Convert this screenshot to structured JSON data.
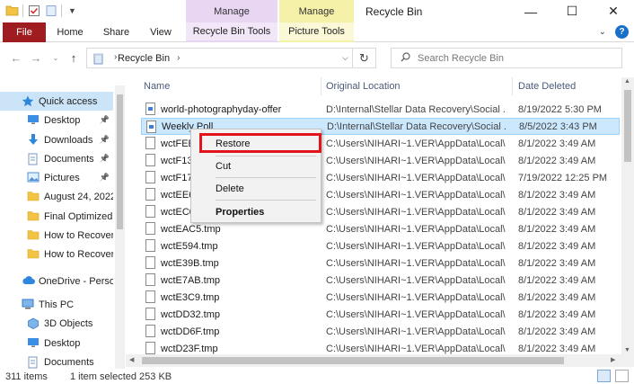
{
  "titlebar": {
    "title": "Recycle Bin",
    "manage_1": "Manage",
    "manage_2": "Manage"
  },
  "ribbon": {
    "file": "File",
    "home": "Home",
    "share": "Share",
    "view": "View",
    "recycle_bin_tools": "Recycle Bin Tools",
    "picture_tools": "Picture Tools"
  },
  "address": {
    "path": "Recycle Bin",
    "search_placeholder": "Search Recycle Bin"
  },
  "sidebar": {
    "items": [
      {
        "label": "Quick access",
        "icon": "star-icon"
      },
      {
        "label": "Desktop",
        "icon": "desktop-icon"
      },
      {
        "label": "Downloads",
        "icon": "download-icon"
      },
      {
        "label": "Documents",
        "icon": "documents-icon"
      },
      {
        "label": "Pictures",
        "icon": "pictures-icon"
      },
      {
        "label": "August 24, 2022",
        "icon": "folder-icon"
      },
      {
        "label": "Final Optimized",
        "icon": "folder-icon"
      },
      {
        "label": "How to Recover",
        "icon": "folder-icon"
      },
      {
        "label": "How to Recover",
        "icon": "folder-icon"
      },
      {
        "label": "OneDrive - Person",
        "icon": "cloud-icon"
      },
      {
        "label": "This PC",
        "icon": "pc-icon"
      },
      {
        "label": "3D Objects",
        "icon": "cube-icon"
      },
      {
        "label": "Desktop",
        "icon": "desktop-icon"
      },
      {
        "label": "Documents",
        "icon": "documents-icon"
      }
    ]
  },
  "columns": {
    "name": "Name",
    "original_location": "Original Location",
    "date_deleted": "Date Deleted"
  },
  "files": [
    {
      "name": "world-photographyday-offer",
      "location": "D:\\Internal\\Stellar Data Recovery\\Social ...",
      "date": "8/19/2022 5:30 PM",
      "icon": "image-file-icon"
    },
    {
      "name": "Weekly Poll",
      "location": "D:\\Internal\\Stellar Data Recovery\\Social ...",
      "date": "8/5/2022 3:43 PM",
      "icon": "image-file-icon"
    },
    {
      "name": "wctFEE",
      "location": "C:\\Users\\NIHARI~1.VER\\AppData\\Local\\...",
      "date": "8/1/2022 3:49 AM",
      "icon": "file-icon"
    },
    {
      "name": "wctF13",
      "location": "C:\\Users\\NIHARI~1.VER\\AppData\\Local\\...",
      "date": "8/1/2022 3:49 AM",
      "icon": "file-icon"
    },
    {
      "name": "wctF17",
      "location": "C:\\Users\\NIHARI~1.VER\\AppData\\Local\\...",
      "date": "7/19/2022 12:25 PM",
      "icon": "file-icon"
    },
    {
      "name": "wctEE6",
      "location": "C:\\Users\\NIHARI~1.VER\\AppData\\Local\\...",
      "date": "8/1/2022 3:49 AM",
      "icon": "file-icon"
    },
    {
      "name": "wctEC0",
      "location": "C:\\Users\\NIHARI~1.VER\\AppData\\Local\\...",
      "date": "8/1/2022 3:49 AM",
      "icon": "file-icon"
    },
    {
      "name": "wctEAC5.tmp",
      "location": "C:\\Users\\NIHARI~1.VER\\AppData\\Local\\...",
      "date": "8/1/2022 3:49 AM",
      "icon": "file-icon"
    },
    {
      "name": "wctE594.tmp",
      "location": "C:\\Users\\NIHARI~1.VER\\AppData\\Local\\...",
      "date": "8/1/2022 3:49 AM",
      "icon": "file-icon"
    },
    {
      "name": "wctE39B.tmp",
      "location": "C:\\Users\\NIHARI~1.VER\\AppData\\Local\\...",
      "date": "8/1/2022 3:49 AM",
      "icon": "file-icon"
    },
    {
      "name": "wctE7AB.tmp",
      "location": "C:\\Users\\NIHARI~1.VER\\AppData\\Local\\...",
      "date": "8/1/2022 3:49 AM",
      "icon": "file-icon"
    },
    {
      "name": "wctE3C9.tmp",
      "location": "C:\\Users\\NIHARI~1.VER\\AppData\\Local\\...",
      "date": "8/1/2022 3:49 AM",
      "icon": "file-icon"
    },
    {
      "name": "wctDD32.tmp",
      "location": "C:\\Users\\NIHARI~1.VER\\AppData\\Local\\...",
      "date": "8/1/2022 3:49 AM",
      "icon": "file-icon"
    },
    {
      "name": "wctDD6F.tmp",
      "location": "C:\\Users\\NIHARI~1.VER\\AppData\\Local\\...",
      "date": "8/1/2022 3:49 AM",
      "icon": "file-icon"
    },
    {
      "name": "wctD23F.tmp",
      "location": "C:\\Users\\NIHARI~1.VER\\AppData\\Local\\...",
      "date": "8/1/2022 3:49 AM",
      "icon": "file-icon"
    }
  ],
  "selected_index": 1,
  "context_menu": {
    "restore": "Restore",
    "cut": "Cut",
    "delete": "Delete",
    "properties": "Properties"
  },
  "status": {
    "items": "311 items",
    "selection": "1 item selected  253 KB"
  },
  "colors": {
    "file_tab": "#9f1d20",
    "manage_purple": "#e8d6f3",
    "manage_yellow": "#f6f1a9",
    "selection": "#cce8ff",
    "highlight_box": "#e1141c"
  }
}
